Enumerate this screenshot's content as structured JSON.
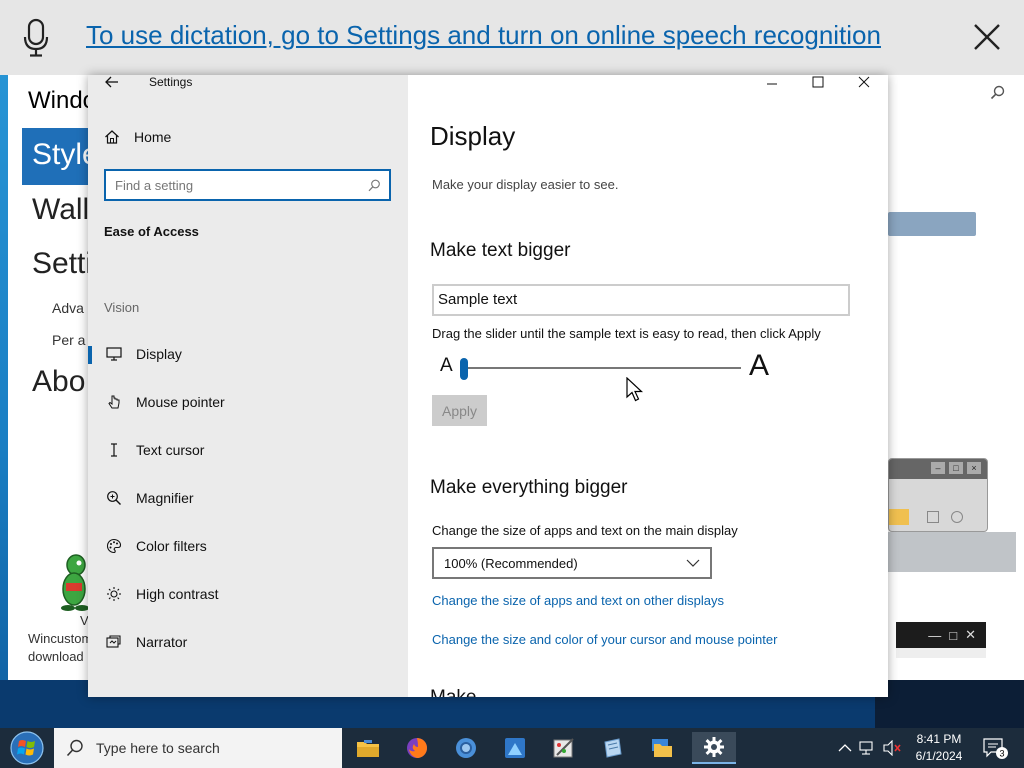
{
  "dictation": {
    "link_text": "To use dictation, go to Settings and turn on online speech recognition"
  },
  "background_window": {
    "title_partial": "Windo",
    "items": [
      "Style",
      "Wall",
      "Setti",
      "Adva",
      "Per a",
      "Abo"
    ],
    "caption_v": "V",
    "caption_1": "Wincustom",
    "caption_2": "download"
  },
  "settings": {
    "window_title": "Settings",
    "home_label": "Home",
    "search_placeholder": "Find a setting",
    "section_label": "Ease of Access",
    "group_label": "Vision",
    "nav": [
      {
        "label": "Display",
        "icon": "monitor-icon",
        "active": true
      },
      {
        "label": "Mouse pointer",
        "icon": "mouse-pointer-icon",
        "active": false
      },
      {
        "label": "Text cursor",
        "icon": "text-cursor-icon",
        "active": false
      },
      {
        "label": "Magnifier",
        "icon": "magnifier-icon",
        "active": false
      },
      {
        "label": "Color filters",
        "icon": "color-palette-icon",
        "active": false
      },
      {
        "label": "High contrast",
        "icon": "sun-icon",
        "active": false
      },
      {
        "label": "Narrator",
        "icon": "narrator-icon",
        "active": false
      }
    ],
    "content": {
      "title": "Display",
      "subtitle": "Make your display easier to see.",
      "text_bigger_heading": "Make text bigger",
      "sample_text": "Sample text",
      "drag_instruction": "Drag the slider until the sample text is easy to read, then click Apply",
      "slider_min_label": "A",
      "slider_max_label": "A",
      "slider_value": 0,
      "apply_label": "Apply",
      "everything_bigger_heading": "Make everything bigger",
      "change_size_label": "Change the size of apps and text on the main display",
      "scale_value": "100% (Recommended)",
      "link_other_displays": "Change the size of apps and text on other displays",
      "link_cursor": "Change the size and color of your cursor and mouse pointer",
      "next_heading_partial": "Make ... "
    }
  },
  "taskbar": {
    "search_placeholder": "Type here to search",
    "apps": [
      "file-explorer-icon",
      "firefox-icon",
      "chrome-icon",
      "app-icon",
      "paint-icon",
      "notes-icon",
      "folder-app-icon",
      "settings-icon"
    ],
    "active_app": "settings-icon",
    "time": "8:41 PM",
    "date": "6/1/2024",
    "notification_count": "3"
  },
  "colors": {
    "accent": "#0a64ad",
    "taskbar": "#1c2c3c",
    "banner": "#e6e6e6",
    "sidebar": "#ebebeb"
  }
}
